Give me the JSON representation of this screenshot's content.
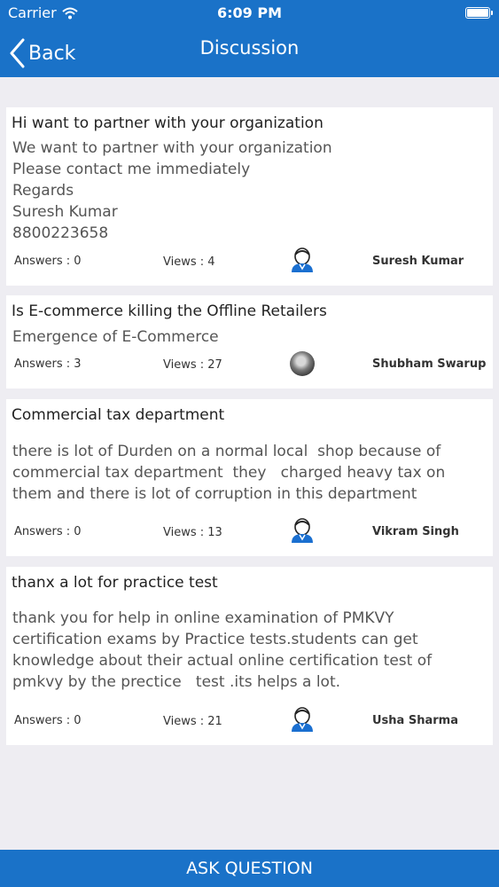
{
  "status_bar": {
    "carrier": "Carrier",
    "time": "6:09 PM",
    "icons": [
      "wifi-icon",
      "battery-icon"
    ]
  },
  "nav": {
    "back_label": "Back",
    "title": "Discussion"
  },
  "posts": [
    {
      "title": "Hi want to partner with your organization",
      "body": [
        "We want to partner with your organization",
        "Please contact me immediately",
        "Regards",
        "Suresh Kumar",
        "8800223658"
      ],
      "answers": "Answers : 0",
      "views": "Views : 4",
      "author": "Suresh Kumar",
      "avatar": "default-user-icon"
    },
    {
      "title": "Is E-commerce killing the Offline Retailers",
      "body": [
        "Emergence of E-Commerce"
      ],
      "answers": "Answers : 3",
      "views": "Views : 27",
      "author": "Shubham Swarup",
      "avatar": "user-photo"
    },
    {
      "title": "Commercial tax department",
      "body": [
        "there is lot of Durden on a normal local  shop because of",
        "commercial tax department  they   charged heavy tax on",
        "them and there is lot of corruption in this department"
      ],
      "answers": "Answers : 0",
      "views": "Views : 13",
      "author": "Vikram Singh",
      "avatar": "default-user-icon"
    },
    {
      "title": "thanx a lot for practice test",
      "body": [
        "thank you for help in online examination of PMKVY",
        "certification exams by Practice tests.students can get",
        "knowledge about their actual online certification test of",
        "pmkvy by the prectice   test .its helps a lot."
      ],
      "answers": "Answers : 0",
      "views": "Views : 21",
      "author": "Usha Sharma",
      "avatar": "default-user-icon"
    }
  ],
  "footer": {
    "ask_label": "ASK QUESTION"
  },
  "colors": {
    "brand": "#1a72c8",
    "background": "#eeedf2",
    "avatar_blue": "#1a6fd0"
  }
}
